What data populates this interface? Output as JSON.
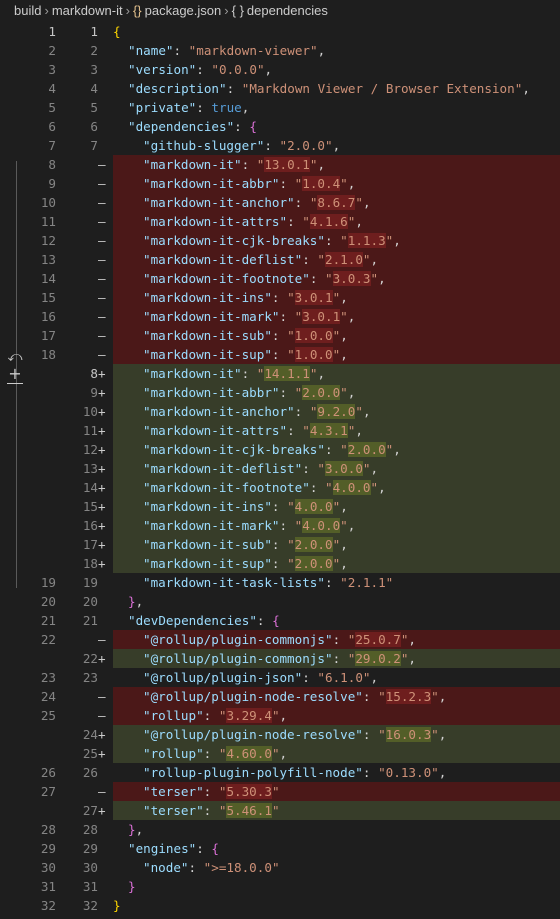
{
  "breadcrumb": {
    "items": [
      "build",
      "markdown-it",
      "package.json",
      "dependencies"
    ],
    "icon_braces": "{}",
    "icon_braces2": "{ }"
  },
  "gutter_actions": {
    "revert_icon": "⤺",
    "stage_icon": "+"
  },
  "lines": [
    {
      "old": "1",
      "new": "1",
      "mark": "",
      "type": "ctx",
      "current": true,
      "indent": 0,
      "text": "{"
    },
    {
      "old": "2",
      "new": "2",
      "mark": "",
      "type": "ctx",
      "indent": 1,
      "key": "name",
      "val": "markdown-viewer"
    },
    {
      "old": "3",
      "new": "3",
      "mark": "",
      "type": "ctx",
      "indent": 1,
      "key": "version",
      "val": "0.0.0"
    },
    {
      "old": "4",
      "new": "4",
      "mark": "",
      "type": "ctx",
      "indent": 1,
      "key": "description",
      "val": "Markdown Viewer / Browser Extension"
    },
    {
      "old": "5",
      "new": "5",
      "mark": "",
      "type": "ctx",
      "indent": 1,
      "key": "private",
      "bool": "true"
    },
    {
      "old": "6",
      "new": "6",
      "mark": "",
      "type": "ctx",
      "indent": 1,
      "key": "dependencies",
      "open": "{"
    },
    {
      "old": "7",
      "new": "7",
      "mark": "",
      "type": "ctx",
      "indent": 2,
      "key": "github-slugger",
      "val": "2.0.0"
    },
    {
      "old": "8",
      "new": "",
      "mark": "—",
      "type": "removed",
      "indent": 2,
      "key": "markdown-it",
      "val": "13.0.1",
      "hl": "13.0.1"
    },
    {
      "old": "9",
      "new": "",
      "mark": "—",
      "type": "removed",
      "indent": 2,
      "key": "markdown-it-abbr",
      "val": "1.0.4",
      "hl": "1.0.4"
    },
    {
      "old": "10",
      "new": "",
      "mark": "—",
      "type": "removed",
      "indent": 2,
      "key": "markdown-it-anchor",
      "val": "8.6.7",
      "hl": "8.6.7"
    },
    {
      "old": "11",
      "new": "",
      "mark": "—",
      "type": "removed",
      "indent": 2,
      "key": "markdown-it-attrs",
      "val": "4.1.6",
      "hl": "4.1.6"
    },
    {
      "old": "12",
      "new": "",
      "mark": "—",
      "type": "removed",
      "indent": 2,
      "key": "markdown-it-cjk-breaks",
      "val": "1.1.3",
      "hl": "1.1.3"
    },
    {
      "old": "13",
      "new": "",
      "mark": "—",
      "type": "removed",
      "indent": 2,
      "key": "markdown-it-deflist",
      "val": "2.1.0",
      "hl": "2.1.0"
    },
    {
      "old": "14",
      "new": "",
      "mark": "—",
      "type": "removed",
      "indent": 2,
      "key": "markdown-it-footnote",
      "val": "3.0.3",
      "hl": "3.0.3"
    },
    {
      "old": "15",
      "new": "",
      "mark": "—",
      "type": "removed",
      "indent": 2,
      "key": "markdown-it-ins",
      "val": "3.0.1",
      "hl": "3.0.1"
    },
    {
      "old": "16",
      "new": "",
      "mark": "—",
      "type": "removed",
      "indent": 2,
      "key": "markdown-it-mark",
      "val": "3.0.1",
      "hl": "3.0.1"
    },
    {
      "old": "17",
      "new": "",
      "mark": "—",
      "type": "removed",
      "indent": 2,
      "key": "markdown-it-sub",
      "val": "1.0.0",
      "hl": "1.0.0"
    },
    {
      "old": "18",
      "new": "",
      "mark": "—",
      "type": "removed",
      "indent": 2,
      "key": "markdown-it-sup",
      "val": "1.0.0",
      "hl": "1.0.0"
    },
    {
      "old": "",
      "new": "8",
      "mark": "+",
      "type": "added",
      "current": true,
      "indent": 2,
      "key": "markdown-it",
      "val": "14.1.1",
      "hl": "14.1.1"
    },
    {
      "old": "",
      "new": "9",
      "mark": "+",
      "type": "added",
      "indent": 2,
      "key": "markdown-it-abbr",
      "val": "2.0.0",
      "hl": "2.0.0"
    },
    {
      "old": "",
      "new": "10",
      "mark": "+",
      "type": "added",
      "indent": 2,
      "key": "markdown-it-anchor",
      "val": "9.2.0",
      "hl": "9.2.0"
    },
    {
      "old": "",
      "new": "11",
      "mark": "+",
      "type": "added",
      "indent": 2,
      "key": "markdown-it-attrs",
      "val": "4.3.1",
      "hl": "4.3.1"
    },
    {
      "old": "",
      "new": "12",
      "mark": "+",
      "type": "added",
      "indent": 2,
      "key": "markdown-it-cjk-breaks",
      "val": "2.0.0",
      "hl": "2.0.0"
    },
    {
      "old": "",
      "new": "13",
      "mark": "+",
      "type": "added",
      "indent": 2,
      "key": "markdown-it-deflist",
      "val": "3.0.0",
      "hl": "3.0.0"
    },
    {
      "old": "",
      "new": "14",
      "mark": "+",
      "type": "added",
      "indent": 2,
      "key": "markdown-it-footnote",
      "val": "4.0.0",
      "hl": "4.0.0"
    },
    {
      "old": "",
      "new": "15",
      "mark": "+",
      "type": "added",
      "indent": 2,
      "key": "markdown-it-ins",
      "val": "4.0.0",
      "hl": "4.0.0"
    },
    {
      "old": "",
      "new": "16",
      "mark": "+",
      "type": "added",
      "indent": 2,
      "key": "markdown-it-mark",
      "val": "4.0.0",
      "hl": "4.0.0"
    },
    {
      "old": "",
      "new": "17",
      "mark": "+",
      "type": "added",
      "indent": 2,
      "key": "markdown-it-sub",
      "val": "2.0.0",
      "hl": "2.0.0"
    },
    {
      "old": "",
      "new": "18",
      "mark": "+",
      "type": "added",
      "indent": 2,
      "key": "markdown-it-sup",
      "val": "2.0.0",
      "hl": "2.0.0"
    },
    {
      "old": "19",
      "new": "19",
      "mark": "",
      "type": "ctx",
      "indent": 2,
      "key": "markdown-it-task-lists",
      "val": "2.1.1",
      "noComma": true
    },
    {
      "old": "20",
      "new": "20",
      "mark": "",
      "type": "ctx",
      "indent": 1,
      "close": "},"
    },
    {
      "old": "21",
      "new": "21",
      "mark": "",
      "type": "ctx",
      "indent": 1,
      "key": "devDependencies",
      "open": "{"
    },
    {
      "old": "22",
      "new": "",
      "mark": "—",
      "type": "removed",
      "indent": 2,
      "key": "@rollup/plugin-commonjs",
      "val": "25.0.7",
      "hl": "25.0.7"
    },
    {
      "old": "",
      "new": "22",
      "mark": "+",
      "type": "added",
      "indent": 2,
      "key": "@rollup/plugin-commonjs",
      "val": "29.0.2",
      "hl": "29.0.2"
    },
    {
      "old": "23",
      "new": "23",
      "mark": "",
      "type": "ctx",
      "indent": 2,
      "key": "@rollup/plugin-json",
      "val": "6.1.0"
    },
    {
      "old": "24",
      "new": "",
      "mark": "—",
      "type": "removed",
      "indent": 2,
      "key": "@rollup/plugin-node-resolve",
      "val": "15.2.3",
      "hl": "15.2.3"
    },
    {
      "old": "25",
      "new": "",
      "mark": "—",
      "type": "removed",
      "indent": 2,
      "key": "rollup",
      "val": "3.29.4",
      "hl": "3.29.4"
    },
    {
      "old": "",
      "new": "24",
      "mark": "+",
      "type": "added",
      "indent": 2,
      "key": "@rollup/plugin-node-resolve",
      "val": "16.0.3",
      "hl": "16.0.3"
    },
    {
      "old": "",
      "new": "25",
      "mark": "+",
      "type": "added",
      "indent": 2,
      "key": "rollup",
      "val": "4.60.0",
      "hl": "4.60.0"
    },
    {
      "old": "26",
      "new": "26",
      "mark": "",
      "type": "ctx",
      "indent": 2,
      "key": "rollup-plugin-polyfill-node",
      "val": "0.13.0"
    },
    {
      "old": "27",
      "new": "",
      "mark": "—",
      "type": "removed",
      "indent": 2,
      "key": "terser",
      "val": "5.30.3",
      "hl": "5.30.3",
      "noComma": true
    },
    {
      "old": "",
      "new": "27",
      "mark": "+",
      "type": "added",
      "indent": 2,
      "key": "terser",
      "val": "5.46.1",
      "hl": "5.46.1",
      "noComma": true
    },
    {
      "old": "28",
      "new": "28",
      "mark": "",
      "type": "ctx",
      "indent": 1,
      "close": "},"
    },
    {
      "old": "29",
      "new": "29",
      "mark": "",
      "type": "ctx",
      "indent": 1,
      "key": "engines",
      "open": "{"
    },
    {
      "old": "30",
      "new": "30",
      "mark": "",
      "type": "ctx",
      "indent": 2,
      "key": "node",
      "val": ">=18.0.0",
      "noComma": true
    },
    {
      "old": "31",
      "new": "31",
      "mark": "",
      "type": "ctx",
      "indent": 1,
      "close": "}"
    },
    {
      "old": "32",
      "new": "32",
      "mark": "",
      "type": "ctx",
      "indent": 0,
      "text": "}"
    }
  ]
}
